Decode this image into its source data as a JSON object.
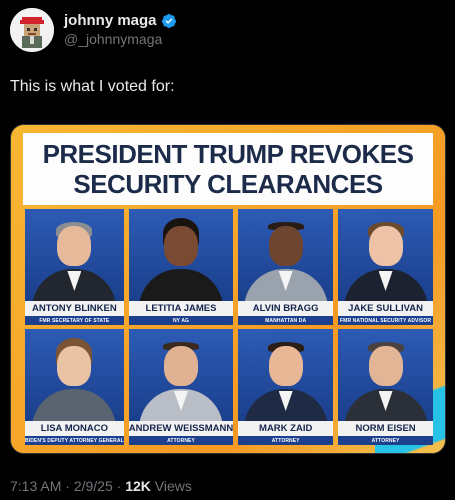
{
  "user": {
    "display_name": "johnny maga",
    "handle": "@_johnnymaga"
  },
  "tweet": {
    "text": "This is what I voted for:"
  },
  "media": {
    "headline_line1": "PRESIDENT TRUMP REVOKES",
    "headline_line2": "SECURITY CLEARANCES",
    "people": [
      {
        "name": "ANTONY BLINKEN",
        "title": "FMR SECRETARY OF STATE"
      },
      {
        "name": "LETITIA JAMES",
        "title": "NY AG"
      },
      {
        "name": "ALVIN BRAGG",
        "title": "MANHATTAN DA"
      },
      {
        "name": "JAKE SULLIVAN",
        "title": "FMR NATIONAL SECURITY ADVISOR"
      },
      {
        "name": "LISA MONACO",
        "title": "BIDEN'S DEPUTY ATTORNEY GENERAL"
      },
      {
        "name": "ANDREW WEISSMANN",
        "title": "ATTORNEY"
      },
      {
        "name": "MARK ZAID",
        "title": "ATTORNEY"
      },
      {
        "name": "NORM EISEN",
        "title": "ATTORNEY"
      }
    ]
  },
  "meta": {
    "time": "7:13 AM",
    "sep1": " · ",
    "date": "2/9/25",
    "sep2": " · ",
    "views_count": "12K",
    "views_label": " Views"
  },
  "colors": {
    "background": "#000000",
    "verified": "#1d9bf0",
    "headline_text": "#1c2b49",
    "frame_orange": "#f5a623",
    "panel_blue": "#1c3f8e"
  },
  "icons": {
    "verified": "verified-badge-icon",
    "avatar": "pixel-avatar-red-cap"
  }
}
